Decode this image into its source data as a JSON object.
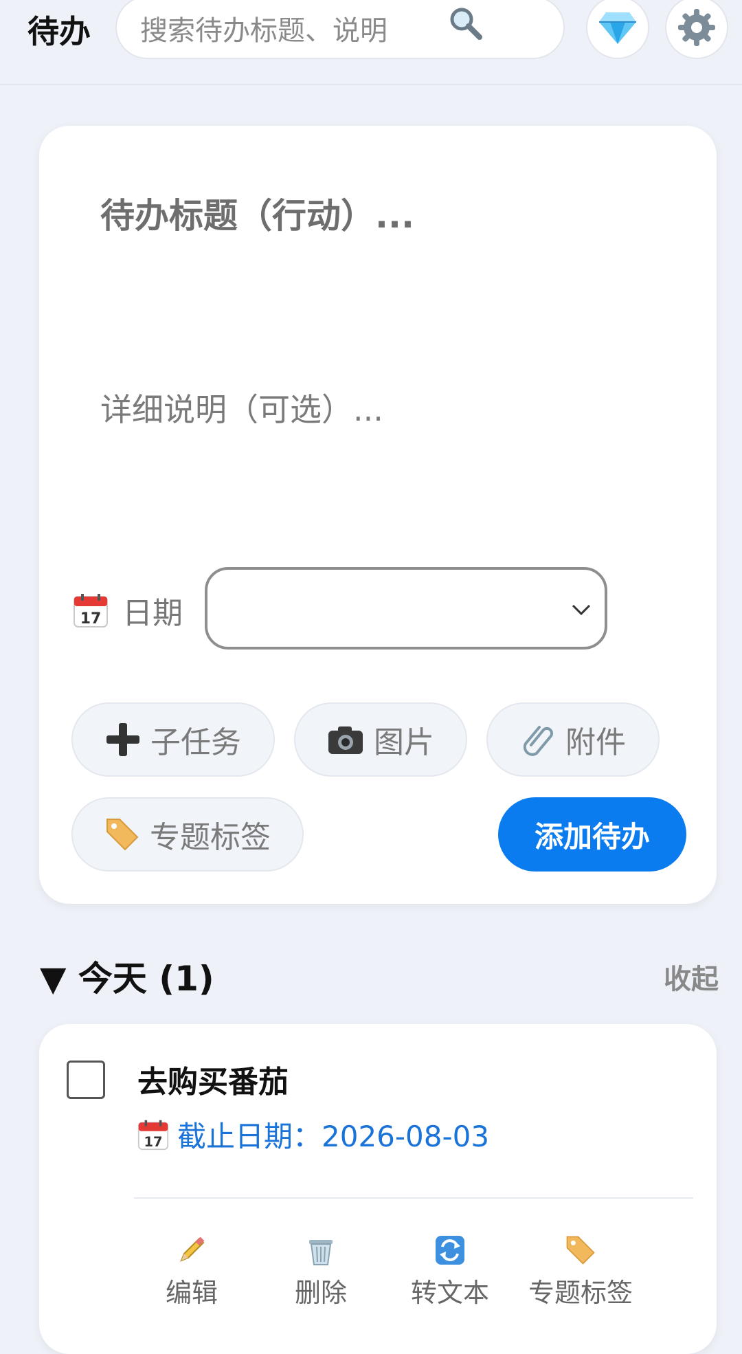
{
  "header": {
    "app_title": "待办",
    "search_placeholder": "搜索待办标题、说明",
    "icons": [
      "search-icon",
      "gem-icon",
      "gear-icon"
    ]
  },
  "composer": {
    "title_placeholder": "待办标题（行动）...",
    "description_placeholder": "详细说明（可选）...",
    "date_label": "日期",
    "date_value": "",
    "chips": {
      "subtask": "子任务",
      "image": "图片",
      "attachment": "附件",
      "tag": "专题标签"
    },
    "add_button": "添加待办"
  },
  "section": {
    "heading": "▼ 今天 (1)",
    "collapse": "收起"
  },
  "todo": {
    "title": "去购买番茄",
    "due": "截止日期：2026-08-03",
    "checked": false,
    "actions": {
      "edit": "编辑",
      "delete": "删除",
      "to_text": "转文本",
      "tag": "专题标签"
    }
  },
  "colors": {
    "background": "#eef2f8",
    "accent": "#0a7cf0",
    "due_text": "#1a73d8"
  }
}
